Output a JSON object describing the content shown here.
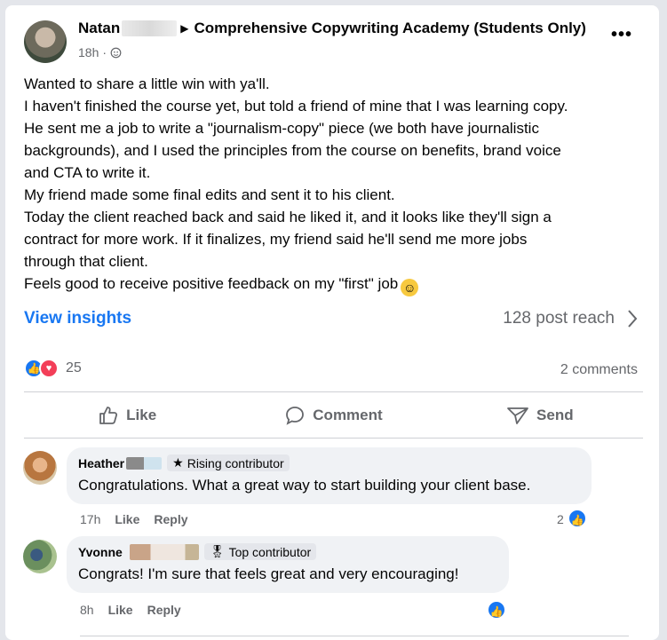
{
  "post": {
    "author": "Natan",
    "group": "Comprehensive Copywriting Academy (Students Only)",
    "time": "18h",
    "body": [
      "Wanted to share a little win with ya'll.",
      "I haven't finished the course yet, but told a friend of mine that I was learning copy.",
      "He sent me a job to write a \"journalism-copy\" piece (we both have journalistic",
      "backgrounds), and I used the principles from the course on benefits, brand voice",
      "and CTA to write it.",
      "My friend made some final edits and sent it to his client.",
      "Today the client reached back and said he liked it, and it looks like they'll sign a",
      "contract for more work. If it finalizes, my friend said he'll send me more jobs",
      "through that client.",
      "Feels good to receive positive feedback on my \"first\" job"
    ],
    "insights_label": "View insights",
    "reach": "128 post reach",
    "reaction_count": "25",
    "comment_count": "2 comments"
  },
  "actions": {
    "like": "Like",
    "comment": "Comment",
    "send": "Send"
  },
  "comments": [
    {
      "name": "Heather",
      "badge": "Rising contributor",
      "text": "Congratulations. What a great way to start building your client base.",
      "time": "17h",
      "like": "Like",
      "reply": "Reply",
      "reaction_count": "2"
    },
    {
      "name": "Yvonne",
      "badge": "Top contributor",
      "text": "Congrats! I'm sure that feels great and very encouraging!",
      "time": "8h",
      "like": "Like",
      "reply": "Reply"
    }
  ],
  "colors": {
    "accent": "#1877f2",
    "love": "#f33e58",
    "bubble": "#f0f2f5",
    "muted": "#65676b"
  },
  "icons": [
    "globe-icon",
    "more-icon",
    "chevron-right-icon",
    "like-icon",
    "comment-icon",
    "send-icon",
    "star-icon",
    "award-icon",
    "emoji-icon"
  ]
}
